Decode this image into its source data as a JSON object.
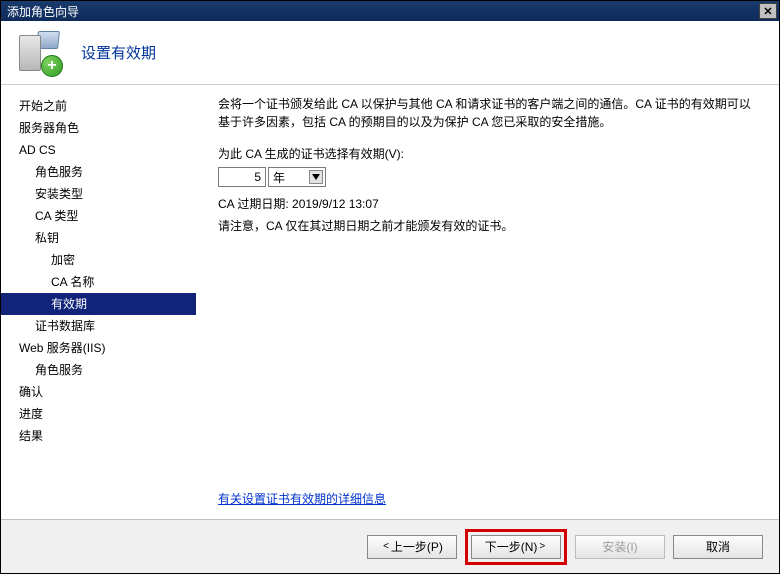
{
  "window": {
    "title": "添加角色向导",
    "close_glyph": "✕"
  },
  "header": {
    "title": "设置有效期"
  },
  "sidebar": {
    "items": [
      {
        "label": "开始之前",
        "indent": 0,
        "selected": false
      },
      {
        "label": "服务器角色",
        "indent": 0,
        "selected": false
      },
      {
        "label": "AD CS",
        "indent": 0,
        "selected": false
      },
      {
        "label": "角色服务",
        "indent": 1,
        "selected": false
      },
      {
        "label": "安装类型",
        "indent": 1,
        "selected": false
      },
      {
        "label": "CA 类型",
        "indent": 1,
        "selected": false
      },
      {
        "label": "私钥",
        "indent": 1,
        "selected": false
      },
      {
        "label": "加密",
        "indent": 2,
        "selected": false
      },
      {
        "label": "CA 名称",
        "indent": 2,
        "selected": false
      },
      {
        "label": "有效期",
        "indent": 2,
        "selected": true
      },
      {
        "label": "证书数据库",
        "indent": 1,
        "selected": false
      },
      {
        "label": "Web 服务器(IIS)",
        "indent": 0,
        "selected": false
      },
      {
        "label": "角色服务",
        "indent": 1,
        "selected": false
      },
      {
        "label": "确认",
        "indent": 0,
        "selected": false
      },
      {
        "label": "进度",
        "indent": 0,
        "selected": false
      },
      {
        "label": "结果",
        "indent": 0,
        "selected": false
      }
    ]
  },
  "content": {
    "intro": "会将一个证书颁发给此 CA 以保护与其他 CA 和请求证书的客户端之间的通信。CA 证书的有效期可以基于许多因素，包括 CA 的预期目的以及为保护 CA 您已采取的安全措施。",
    "select_label": "为此 CA 生成的证书选择有效期(V):",
    "duration_value": "5",
    "duration_unit": "年",
    "expiry_label": "CA 过期日期: ",
    "expiry_value": "2019/9/12 13:07",
    "note": "请注意，CA 仅在其过期日期之前才能颁发有效的证书。",
    "link_text": "有关设置证书有效期的详细信息"
  },
  "footer": {
    "prev": "上一步(P)",
    "next": "下一步(N)",
    "install": "安装(I)",
    "cancel": "取消"
  }
}
